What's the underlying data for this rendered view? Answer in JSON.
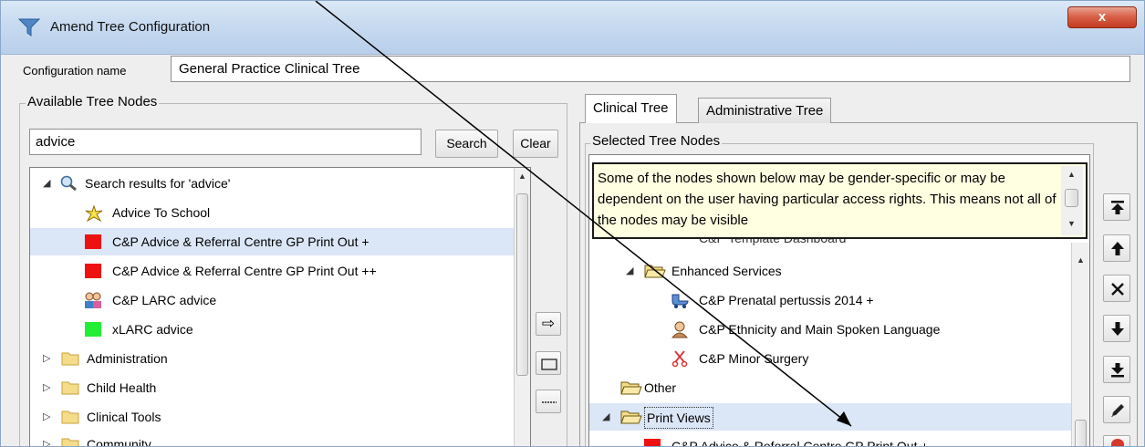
{
  "window": {
    "title": "Amend Tree Configuration",
    "close_label": "x"
  },
  "config": {
    "label": "Configuration name",
    "value": "General Practice Clinical Tree"
  },
  "available": {
    "legend": "Available Tree Nodes",
    "search_value": "advice",
    "search_label": "Search",
    "clear_label": "Clear",
    "tree": [
      {
        "label": "Search results for 'advice'",
        "icon": "magnifier-icon"
      },
      {
        "label": "Advice To School",
        "icon": "star-burst-icon"
      },
      {
        "label": "C&P Advice & Referral Centre GP Print Out +",
        "icon": "red-square-icon"
      },
      {
        "label": "C&P Advice & Referral Centre GP Print Out ++",
        "icon": "red-square-icon"
      },
      {
        "label": "C&P LARC advice",
        "icon": "people-icon"
      },
      {
        "label": "xLARC advice",
        "icon": "green-square-icon"
      },
      {
        "label": "Administration",
        "icon": "folder-icon"
      },
      {
        "label": "Child Health",
        "icon": "folder-icon"
      },
      {
        "label": "Clinical Tools",
        "icon": "folder-icon"
      },
      {
        "label": "Community",
        "icon": "folder-icon"
      }
    ]
  },
  "middle_buttons": {
    "add_icon": "⇨",
    "folder_icon": "folder",
    "separator_icon": "separator"
  },
  "tabs": {
    "clinical": "Clinical Tree",
    "administrative": "Administrative Tree"
  },
  "selected": {
    "legend": "Selected Tree Nodes",
    "note": "Some of the nodes shown below may be gender-specific or may be dependent on the user having particular access rights. This means not all of the nodes may be visible",
    "partial_row": "C&P Template Dashboard",
    "tree": [
      {
        "label": "Enhanced Services",
        "icon": "open-folder-icon"
      },
      {
        "label": "C&P Prenatal pertussis 2014 +",
        "icon": "pram-icon"
      },
      {
        "label": "C&P Ethnicity and Main Spoken Language",
        "icon": "person-icon"
      },
      {
        "label": "C&P Minor Surgery",
        "icon": "scissors-icon"
      },
      {
        "label": "Other",
        "icon": "open-folder-icon"
      },
      {
        "label": "Print Views",
        "icon": "open-folder-icon"
      },
      {
        "label": "C&P Advice & Referral Centre GP Print Out +",
        "icon": "red-square-icon"
      }
    ]
  },
  "colors": {
    "selection": "#dbe6f6",
    "note_bg": "#ffffe1",
    "close": "#c23a20"
  }
}
